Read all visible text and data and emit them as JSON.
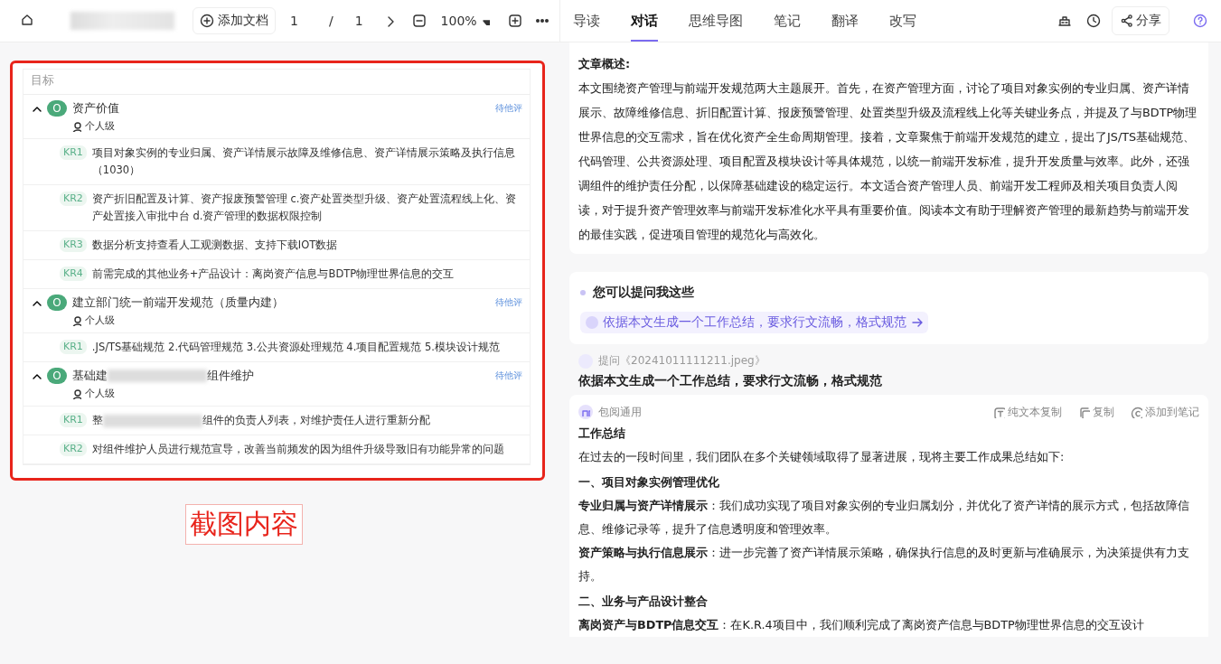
{
  "toolbar": {
    "add_document": "添加文档",
    "page_current": "1",
    "page_separator": "/",
    "page_total": "1",
    "zoom": "100%",
    "share": "分享"
  },
  "tabs": [
    {
      "label": "导读",
      "selected": false
    },
    {
      "label": "对话",
      "selected": true
    },
    {
      "label": "思维导图",
      "selected": false
    },
    {
      "label": "笔记",
      "selected": false
    },
    {
      "label": "翻译",
      "selected": false
    },
    {
      "label": "改写",
      "selected": false
    }
  ],
  "okr_panel": {
    "header": "目标",
    "objectives": [
      {
        "badge": "O",
        "title": "资产价值",
        "expanded": true,
        "status": "待他评",
        "level": "个人级",
        "key_results": [
          {
            "label": "KR1",
            "text": "项目对象实例的专业归属、资产详情展示故障及维修信息、资产详情展示策略及执行信息（1030）"
          },
          {
            "label": "KR2",
            "text": "资产折旧配置及计算、资产报废预警管理 c.资产处置类型升级、资产处置流程线上化、资产处置接入审批中台 d.资产管理的数据权限控制"
          },
          {
            "label": "KR3",
            "text": "数据分析支持查看人工观测数据、支持下载IOT数据"
          },
          {
            "label": "KR4",
            "text": "前需完成的其他业务+产品设计：离岗资产信息与BDTP物理世界信息的交互"
          }
        ]
      },
      {
        "badge": "O",
        "title": "建立部门统一前端开发规范（质量内建）",
        "expanded": true,
        "status": "待他评",
        "level": "个人级",
        "key_results": [
          {
            "label": "KR1",
            "text": ".JS/TS基础规范 2.代码管理规范 3.公共资源处理规范 4.项目配置规范 5.模块设计规范"
          }
        ]
      },
      {
        "badge": "O",
        "title": "基础建",
        "title_tail": "组件维护",
        "expanded": true,
        "status": "待他评",
        "level": "个人级",
        "key_results": [
          {
            "label": "KR1",
            "text": "整",
            "text_tail": "组件的负责人列表，对维护责任人进行重新分配"
          },
          {
            "label": "KR2",
            "text": "对组件维护人员进行规范宣导，改善当前频发的因为组件升级导致旧有功能异常的问题"
          }
        ]
      }
    ]
  },
  "annotation": {
    "label": "截图内容"
  },
  "summary": {
    "heading": "文章概述:",
    "text": "本文围绕资产管理与前端开发规范两大主题展开。首先，在资产管理方面，讨论了项目对象实例的专业归属、资产详情展示、故障维修信息、折旧配置计算、报废预警管理、处置类型升级及流程线上化等关键业务点，并提及了与BDTP物理世界信息的交互需求，旨在优化资产全生命周期管理。接着，文章聚焦于前端开发规范的建立，提出了JS/TS基础规范、代码管理、公共资源处理、项目配置及模块设计等具体规范，以统一前端开发标准，提升开发质量与效率。此外，还强调组件的维护责任分配，以保障基础建设的稳定运行。本文适合资产管理人员、前端开发工程师及相关项目负责人阅读，对于提升资产管理效率与前端开发标准化水平具有重要价值。阅读本文有助于理解资产管理的最新趋势与前端开发的最佳实践，促进项目管理的规范化与高效化。"
  },
  "suggestions": {
    "title": "您可以提问我这些",
    "items": [
      "依据本文生成一个工作总结，要求行文流畅，格式规范"
    ]
  },
  "question": {
    "meta": "提问《20241011111211.jpeg》",
    "text": "依据本文生成一个工作总结，要求行文流畅，格式规范"
  },
  "answer": {
    "source": "包阅通用",
    "actions": [
      {
        "kind": "plain-copy",
        "label": "纯文本复制"
      },
      {
        "kind": "copy",
        "label": "复制"
      },
      {
        "kind": "note",
        "label": "添加到笔记"
      }
    ],
    "blocks": [
      {
        "kind": "heading",
        "text": "工作总结"
      },
      {
        "kind": "paragraph",
        "text": "在过去的一段时间里，我们团队在多个关键领域取得了显著进展，现将主要工作成果总结如下:"
      },
      {
        "kind": "heading",
        "text": "一、项目对象实例管理优化"
      },
      {
        "kind": "paragraph",
        "text": "**专业归属与资产详情展示**：我们成功实现了项目对象实例的专业归属划分，并优化了资产详情的展示方式，包括故障信息、维修记录等，提升了信息透明度和管理效率。"
      },
      {
        "kind": "paragraph",
        "text": "**资产策略与执行信息展示**：进一步完善了资产详情展示策略，确保执行信息的及时更新与准确展示，为决策提供有力支持。"
      },
      {
        "kind": "heading",
        "text": "二、业务与产品设计整合"
      },
      {
        "kind": "paragraph",
        "text": "**离岗资产与BDTP信息交互**：在K.R.4项目中，我们顺利完成了离岗资产信息与BDTP物理世界信息的交互设计"
      }
    ]
  }
}
